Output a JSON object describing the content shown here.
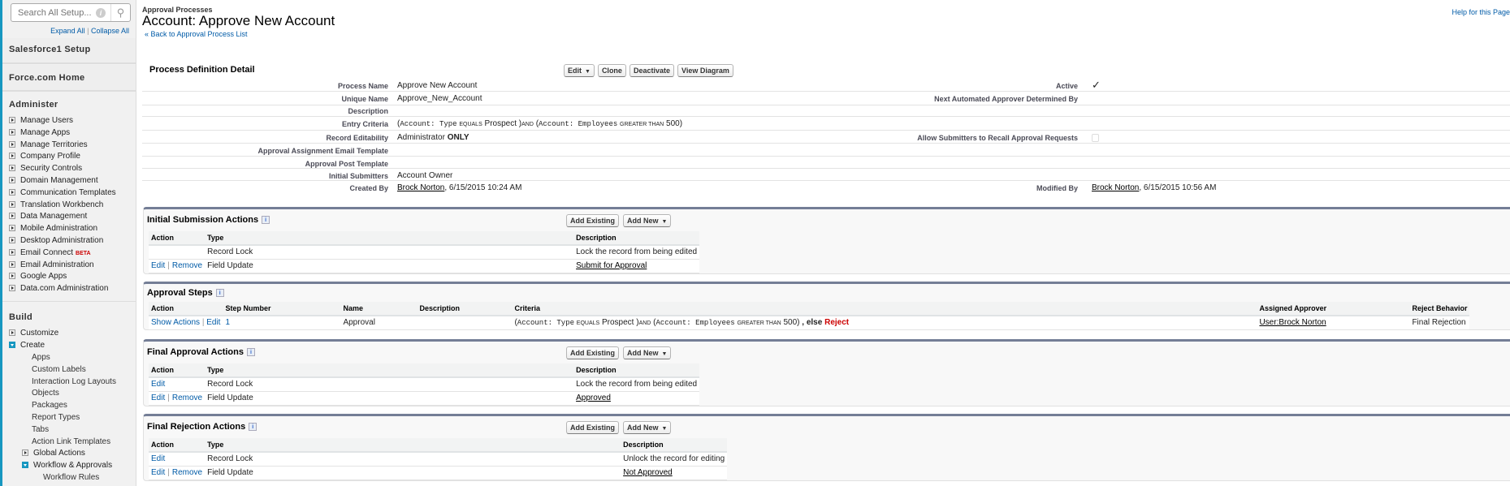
{
  "sidebar": {
    "search_placeholder": "Search All Setup...",
    "expand_all": "Expand All",
    "separator": "|",
    "collapse_all": "Collapse All",
    "salesforce1_setup": "Salesforce1 Setup",
    "force_home": "Force.com Home",
    "administer": {
      "heading": "Administer",
      "items": [
        "Manage Users",
        "Manage Apps",
        "Manage Territories",
        "Company Profile",
        "Security Controls",
        "Domain Management",
        "Communication Templates",
        "Translation Workbench",
        "Data Management",
        "Mobile Administration",
        "Desktop Administration",
        "Email Connect",
        "Email Administration",
        "Google Apps",
        "Data.com Administration"
      ],
      "beta_badge": "BETA"
    },
    "build": {
      "heading": "Build",
      "customize": "Customize",
      "create": "Create",
      "create_items": [
        "Apps",
        "Custom Labels",
        "Interaction Log Layouts",
        "Objects",
        "Packages",
        "Report Types",
        "Tabs",
        "Action Link Templates"
      ],
      "global_actions": "Global Actions",
      "workflow": "Workflow & Approvals",
      "workflow_items": [
        "Workflow Rules"
      ]
    }
  },
  "header": {
    "breadcrumb": "Approval Processes",
    "title": "Account: Approve New Account",
    "back_link": "« Back to Approval Process List",
    "help": "Help for this Page"
  },
  "detail": {
    "heading": "Process Definition Detail",
    "buttons": {
      "edit": "Edit",
      "clone": "Clone",
      "deactivate": "Deactivate",
      "view_diagram": "View Diagram"
    },
    "fields": {
      "process_name": {
        "label": "Process Name",
        "value": "Approve New Account"
      },
      "unique_name": {
        "label": "Unique Name",
        "value": "Approve_New_Account"
      },
      "description": {
        "label": "Description",
        "value": ""
      },
      "entry_criteria": {
        "label": "Entry Criteria"
      },
      "record_editability": {
        "label": "Record Editability",
        "value": "Administrator",
        "value_strong": "ONLY"
      },
      "email_template": {
        "label": "Approval Assignment Email Template"
      },
      "post_template": {
        "label": "Approval Post Template"
      },
      "initial_submitters": {
        "label": "Initial Submitters",
        "value": "Account Owner"
      },
      "created_by": {
        "label": "Created By",
        "user": "Brock Norton",
        "date": ", 6/15/2015 10:24 AM"
      },
      "active": {
        "label": "Active",
        "checked": true
      },
      "next_approver": {
        "label": "Next Automated Approver Determined By"
      },
      "allow_recall": {
        "label": "Allow Submitters to Recall Approval Requests",
        "checked": false
      },
      "modified_by": {
        "label": "Modified By",
        "user": "Brock Norton",
        "date": ", 6/15/2015 10:56 AM"
      }
    }
  },
  "criteria": {
    "p1": "(",
    "f1": "Account: Type",
    "op1": "EQUALS",
    "v1": "Prospect",
    "c1": ")",
    "and": "AND",
    "p2": "(",
    "f2": "Account: Employees",
    "op2": "GREATER THAN",
    "v2": "500",
    "c2": ")",
    "else": ", else",
    "reject": "Reject"
  },
  "section_buttons": {
    "add_existing": "Add Existing",
    "add_new": "Add New"
  },
  "initial_submission": {
    "title": "Initial Submission Actions",
    "columns": [
      "Action",
      "Type",
      "Description"
    ],
    "rows": [
      {
        "action_edit": "",
        "action_remove": "",
        "type": "Record Lock",
        "description": "Lock the record from being edited"
      },
      {
        "action_edit": "Edit",
        "action_remove": "Remove",
        "type": "Field Update",
        "description": "Submit for Approval"
      }
    ]
  },
  "approval_steps": {
    "title": "Approval Steps",
    "columns": [
      "Action",
      "Step Number",
      "Name",
      "Description",
      "Criteria",
      "Assigned Approver",
      "Reject Behavior"
    ],
    "rows": [
      {
        "show_actions": "Show Actions",
        "edit": "Edit",
        "step": "1",
        "name": "Approval",
        "description": "",
        "approver": "User:Brock Norton",
        "reject_behavior": "Final Rejection"
      }
    ]
  },
  "final_approval": {
    "title": "Final Approval Actions",
    "columns": [
      "Action",
      "Type",
      "Description"
    ],
    "rows": [
      {
        "action_edit": "Edit",
        "action_remove": "",
        "type": "Record Lock",
        "description": "Lock the record from being edited"
      },
      {
        "action_edit": "Edit",
        "action_remove": "Remove",
        "type": "Field Update",
        "description": "Approved"
      }
    ]
  },
  "final_rejection": {
    "title": "Final Rejection Actions",
    "columns": [
      "Action",
      "Type",
      "Description"
    ],
    "rows": [
      {
        "action_edit": "Edit",
        "action_remove": "",
        "type": "Record Lock",
        "description": "Unlock the record for editing"
      },
      {
        "action_edit": "Edit",
        "action_remove": "Remove",
        "type": "Field Update",
        "description": "Not Approved"
      }
    ]
  }
}
